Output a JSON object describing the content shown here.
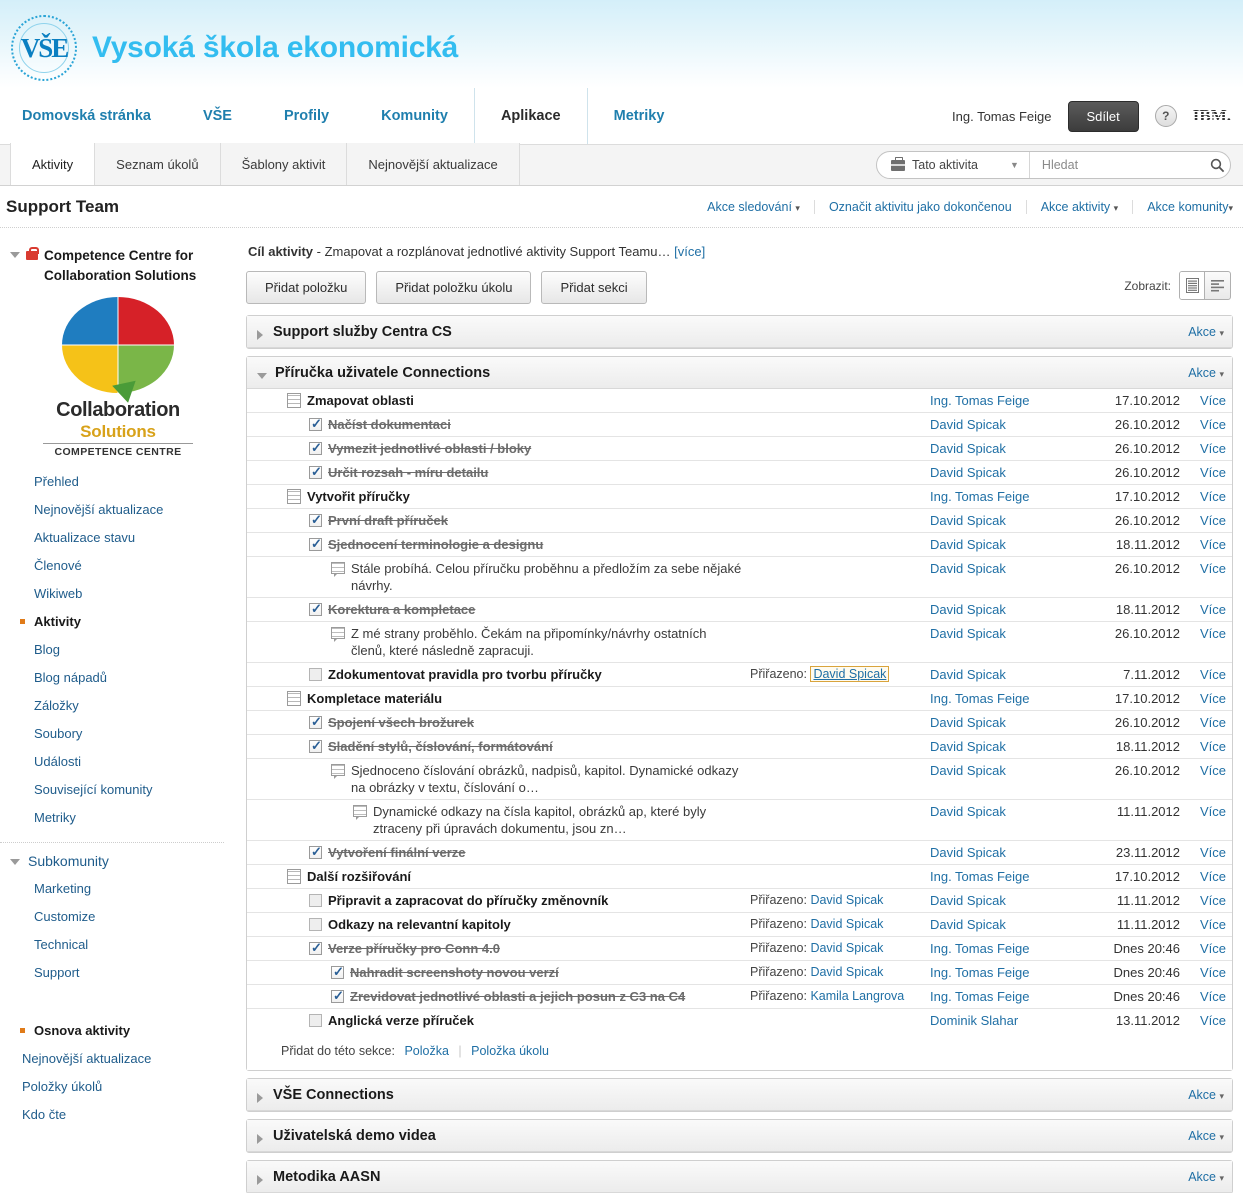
{
  "brand": {
    "seal_letters": "VŠE",
    "title": "Vysoká škola ekonomická"
  },
  "topnav": {
    "links": [
      {
        "label": "Domovská stránka",
        "current": false
      },
      {
        "label": "VŠE",
        "current": false
      },
      {
        "label": "Profily",
        "current": false
      },
      {
        "label": "Komunity",
        "current": false
      },
      {
        "label": "Aplikace",
        "current": true
      },
      {
        "label": "Metriky",
        "current": false
      }
    ],
    "user_name": "Ing. Tomas Feige",
    "share_label": "Sdílet",
    "help_label": "?",
    "ibm_label": "IBM."
  },
  "appbar": {
    "tabs": [
      {
        "label": "Aktivity",
        "active": true
      },
      {
        "label": "Seznam úkolů",
        "active": false
      },
      {
        "label": "Šablony aktivit",
        "active": false
      },
      {
        "label": "Nejnovější aktualizace",
        "active": false
      }
    ],
    "search": {
      "scope_label": "Tato aktivita",
      "placeholder": "Hledat",
      "value": ""
    }
  },
  "page": {
    "title": "Support Team",
    "actions": [
      {
        "label": "Akce sledování",
        "caret": true
      },
      {
        "label": "Označit aktivitu jako dokončenou",
        "caret": false
      },
      {
        "label": "Akce aktivity",
        "caret": true
      },
      {
        "label": "Akce komunity",
        "caret": true
      }
    ]
  },
  "sidebar": {
    "community": {
      "name": "Competence Centre for Collaboration Solutions",
      "private": true
    },
    "logo": {
      "line1": "Collaboration",
      "line2": "Solutions",
      "line3": "COMPETENCE CENTRE"
    },
    "items": [
      {
        "label": "Přehled",
        "active": false
      },
      {
        "label": "Nejnovější aktualizace",
        "active": false
      },
      {
        "label": "Aktualizace stavu",
        "active": false
      },
      {
        "label": "Členové",
        "active": false
      },
      {
        "label": "Wikiweb",
        "active": false
      },
      {
        "label": "Aktivity",
        "active": true
      },
      {
        "label": "Blog",
        "active": false
      },
      {
        "label": "Blog nápadů",
        "active": false
      },
      {
        "label": "Záložky",
        "active": false
      },
      {
        "label": "Soubory",
        "active": false
      },
      {
        "label": "Události",
        "active": false
      },
      {
        "label": "Související komunity",
        "active": false
      },
      {
        "label": "Metriky",
        "active": false
      }
    ],
    "subcommunities": {
      "title": "Subkomunity",
      "items": [
        {
          "label": "Marketing"
        },
        {
          "label": "Customize"
        },
        {
          "label": "Technical"
        },
        {
          "label": "Support"
        }
      ]
    },
    "outline": {
      "title": "Osnova aktivity",
      "items": [
        {
          "label": "Nejnovější aktualizace"
        },
        {
          "label": "Položky úkolů"
        },
        {
          "label": "Kdo čte"
        }
      ]
    }
  },
  "main": {
    "goal_label": "Cíl aktivity",
    "goal_text": "- Zmapovat a rozplánovat jednotlivé aktivity Support Teamu…",
    "goal_more": "[více]",
    "toolbar": {
      "add_item": "Přidat položku",
      "add_todo": "Přidat položku úkolu",
      "add_section": "Přidat sekci",
      "view_label": "Zobrazit:"
    },
    "sections": [
      {
        "title": "Support služby Centra CS",
        "expanded": false,
        "actions_label": "Akce",
        "rows": []
      },
      {
        "title": "Příručka uživatele Connections",
        "expanded": true,
        "actions_label": "Akce",
        "add_to_section_label": "Přidat do této sekce:",
        "add_item_link": "Položka",
        "add_todo_link": "Položka úkolu",
        "rows": [
          {
            "indent": 0,
            "icon": "doc",
            "text": "Zmapovat oblasti",
            "style": "strong",
            "assigned": "",
            "author": "Ing. Tomas Feige",
            "date": "17.10.2012",
            "more": "Více"
          },
          {
            "indent": 1,
            "icon": "checked",
            "text": "Načíst dokumentaci",
            "style": "done",
            "assigned": "",
            "author": "David Spicak",
            "date": "26.10.2012",
            "more": "Více"
          },
          {
            "indent": 1,
            "icon": "checked",
            "text": "Vymezit jednotlivé oblasti / bloky",
            "style": "done",
            "assigned": "",
            "author": "David Spicak",
            "date": "26.10.2012",
            "more": "Více"
          },
          {
            "indent": 1,
            "icon": "checked",
            "text": "Určit rozsah - míru detailu",
            "style": "done",
            "assigned": "",
            "author": "David Spicak",
            "date": "26.10.2012",
            "more": "Více"
          },
          {
            "indent": 0,
            "icon": "doc",
            "text": "Vytvořit příručky",
            "style": "strong",
            "assigned": "",
            "author": "Ing. Tomas Feige",
            "date": "17.10.2012",
            "more": "Více"
          },
          {
            "indent": 1,
            "icon": "checked",
            "text": "První draft příruček",
            "style": "done",
            "assigned": "",
            "author": "David Spicak",
            "date": "26.10.2012",
            "more": "Více"
          },
          {
            "indent": 1,
            "icon": "checked",
            "text": "Sjednocení terminologie a designu",
            "style": "done",
            "assigned": "",
            "author": "David Spicak",
            "date": "18.11.2012",
            "more": "Více"
          },
          {
            "indent": 2,
            "icon": "note",
            "text": "Stále probíhá. Celou příručku proběhnu a předložím za sebe nějaké návrhy.",
            "style": "plain",
            "assigned": "",
            "author": "David Spicak",
            "date": "26.10.2012",
            "more": "Více"
          },
          {
            "indent": 1,
            "icon": "checked",
            "text": "Korektura a kompletace",
            "style": "done",
            "assigned": "",
            "author": "David Spicak",
            "date": "18.11.2012",
            "more": "Více"
          },
          {
            "indent": 2,
            "icon": "note",
            "text": "Z mé strany proběhlo. Čekám na připomínky/návrhy ostatních členů, které následně zapracuji.",
            "style": "plain",
            "assigned": "",
            "author": "David Spicak",
            "date": "26.10.2012",
            "more": "Více"
          },
          {
            "indent": 1,
            "icon": "empty",
            "text": "Zdokumentovat pravidla pro tvorbu příručky",
            "style": "strong",
            "assigned_label": "Přiřazeno:",
            "assigned": "David Spicak",
            "assigned_boxed": true,
            "author": "David Spicak",
            "date": "7.11.2012",
            "more": "Více"
          },
          {
            "indent": 0,
            "icon": "doc",
            "text": "Kompletace materiálu",
            "style": "strong",
            "assigned": "",
            "author": "Ing. Tomas Feige",
            "date": "17.10.2012",
            "more": "Více"
          },
          {
            "indent": 1,
            "icon": "checked",
            "text": "Spojení všech brožurek",
            "style": "done",
            "assigned": "",
            "author": "David Spicak",
            "date": "26.10.2012",
            "more": "Více"
          },
          {
            "indent": 1,
            "icon": "checked",
            "text": "Sladění stylů, číslování, formátování",
            "style": "done",
            "assigned": "",
            "author": "David Spicak",
            "date": "18.11.2012",
            "more": "Více"
          },
          {
            "indent": 2,
            "icon": "note",
            "text": "Sjednoceno číslování obrázků, nadpisů, kapitol. Dynamické odkazy na obrázky v textu, číslování o…",
            "style": "plain",
            "assigned": "",
            "author": "David Spicak",
            "date": "26.10.2012",
            "more": "Více"
          },
          {
            "indent": 3,
            "icon": "note",
            "text": "Dynamické odkazy na čísla kapitol, obrázků ap, které byly ztraceny při úpravách dokumentu, jsou zn…",
            "style": "plain",
            "assigned": "",
            "author": "David Spicak",
            "date": "11.11.2012",
            "more": "Více"
          },
          {
            "indent": 1,
            "icon": "checked",
            "text": "Vytvoření finální verze",
            "style": "done",
            "assigned": "",
            "author": "David Spicak",
            "date": "23.11.2012",
            "more": "Více"
          },
          {
            "indent": 0,
            "icon": "doc",
            "text": "Další rozšiřování",
            "style": "strong",
            "assigned": "",
            "author": "Ing. Tomas Feige",
            "date": "17.10.2012",
            "more": "Více"
          },
          {
            "indent": 1,
            "icon": "empty",
            "text": "Připravit a zapracovat do příručky změnovník",
            "style": "strong",
            "assigned_label": "Přiřazeno:",
            "assigned": "David Spicak",
            "author": "David Spicak",
            "date": "11.11.2012",
            "more": "Více"
          },
          {
            "indent": 1,
            "icon": "empty",
            "text": "Odkazy na relevantní kapitoly",
            "style": "strong",
            "assigned_label": "Přiřazeno:",
            "assigned": "David Spicak",
            "author": "David Spicak",
            "date": "11.11.2012",
            "more": "Více"
          },
          {
            "indent": 1,
            "icon": "checked",
            "text": "Verze příručky pro Conn 4.0",
            "style": "done",
            "assigned_label": "Přiřazeno:",
            "assigned": "David Spicak",
            "author": "Ing. Tomas Feige",
            "date": "Dnes 20:46",
            "more": "Více"
          },
          {
            "indent": 2,
            "icon": "checked",
            "text": "Nahradit screenshoty novou verzí",
            "style": "done",
            "assigned_label": "Přiřazeno:",
            "assigned": "David Spicak",
            "author": "Ing. Tomas Feige",
            "date": "Dnes 20:46",
            "more": "Více"
          },
          {
            "indent": 2,
            "icon": "checked",
            "text": "Zrevidovat jednotlivé oblasti a jejich posun z C3 na C4",
            "style": "done",
            "assigned_label": "Přiřazeno:",
            "assigned": "Kamila Langrova",
            "author": "Ing. Tomas Feige",
            "date": "Dnes 20:46",
            "more": "Více"
          },
          {
            "indent": 1,
            "icon": "empty",
            "text": "Anglická verze příruček",
            "style": "strong",
            "assigned": "",
            "author": "Dominik Slahar",
            "date": "13.11.2012",
            "more": "Více"
          }
        ]
      },
      {
        "title": "VŠE Connections",
        "expanded": false,
        "actions_label": "Akce",
        "rows": []
      },
      {
        "title": "Uživatelská demo videa",
        "expanded": false,
        "actions_label": "Akce",
        "rows": []
      },
      {
        "title": "Metodika AASN",
        "expanded": false,
        "actions_label": "Akce",
        "rows": []
      }
    ]
  }
}
